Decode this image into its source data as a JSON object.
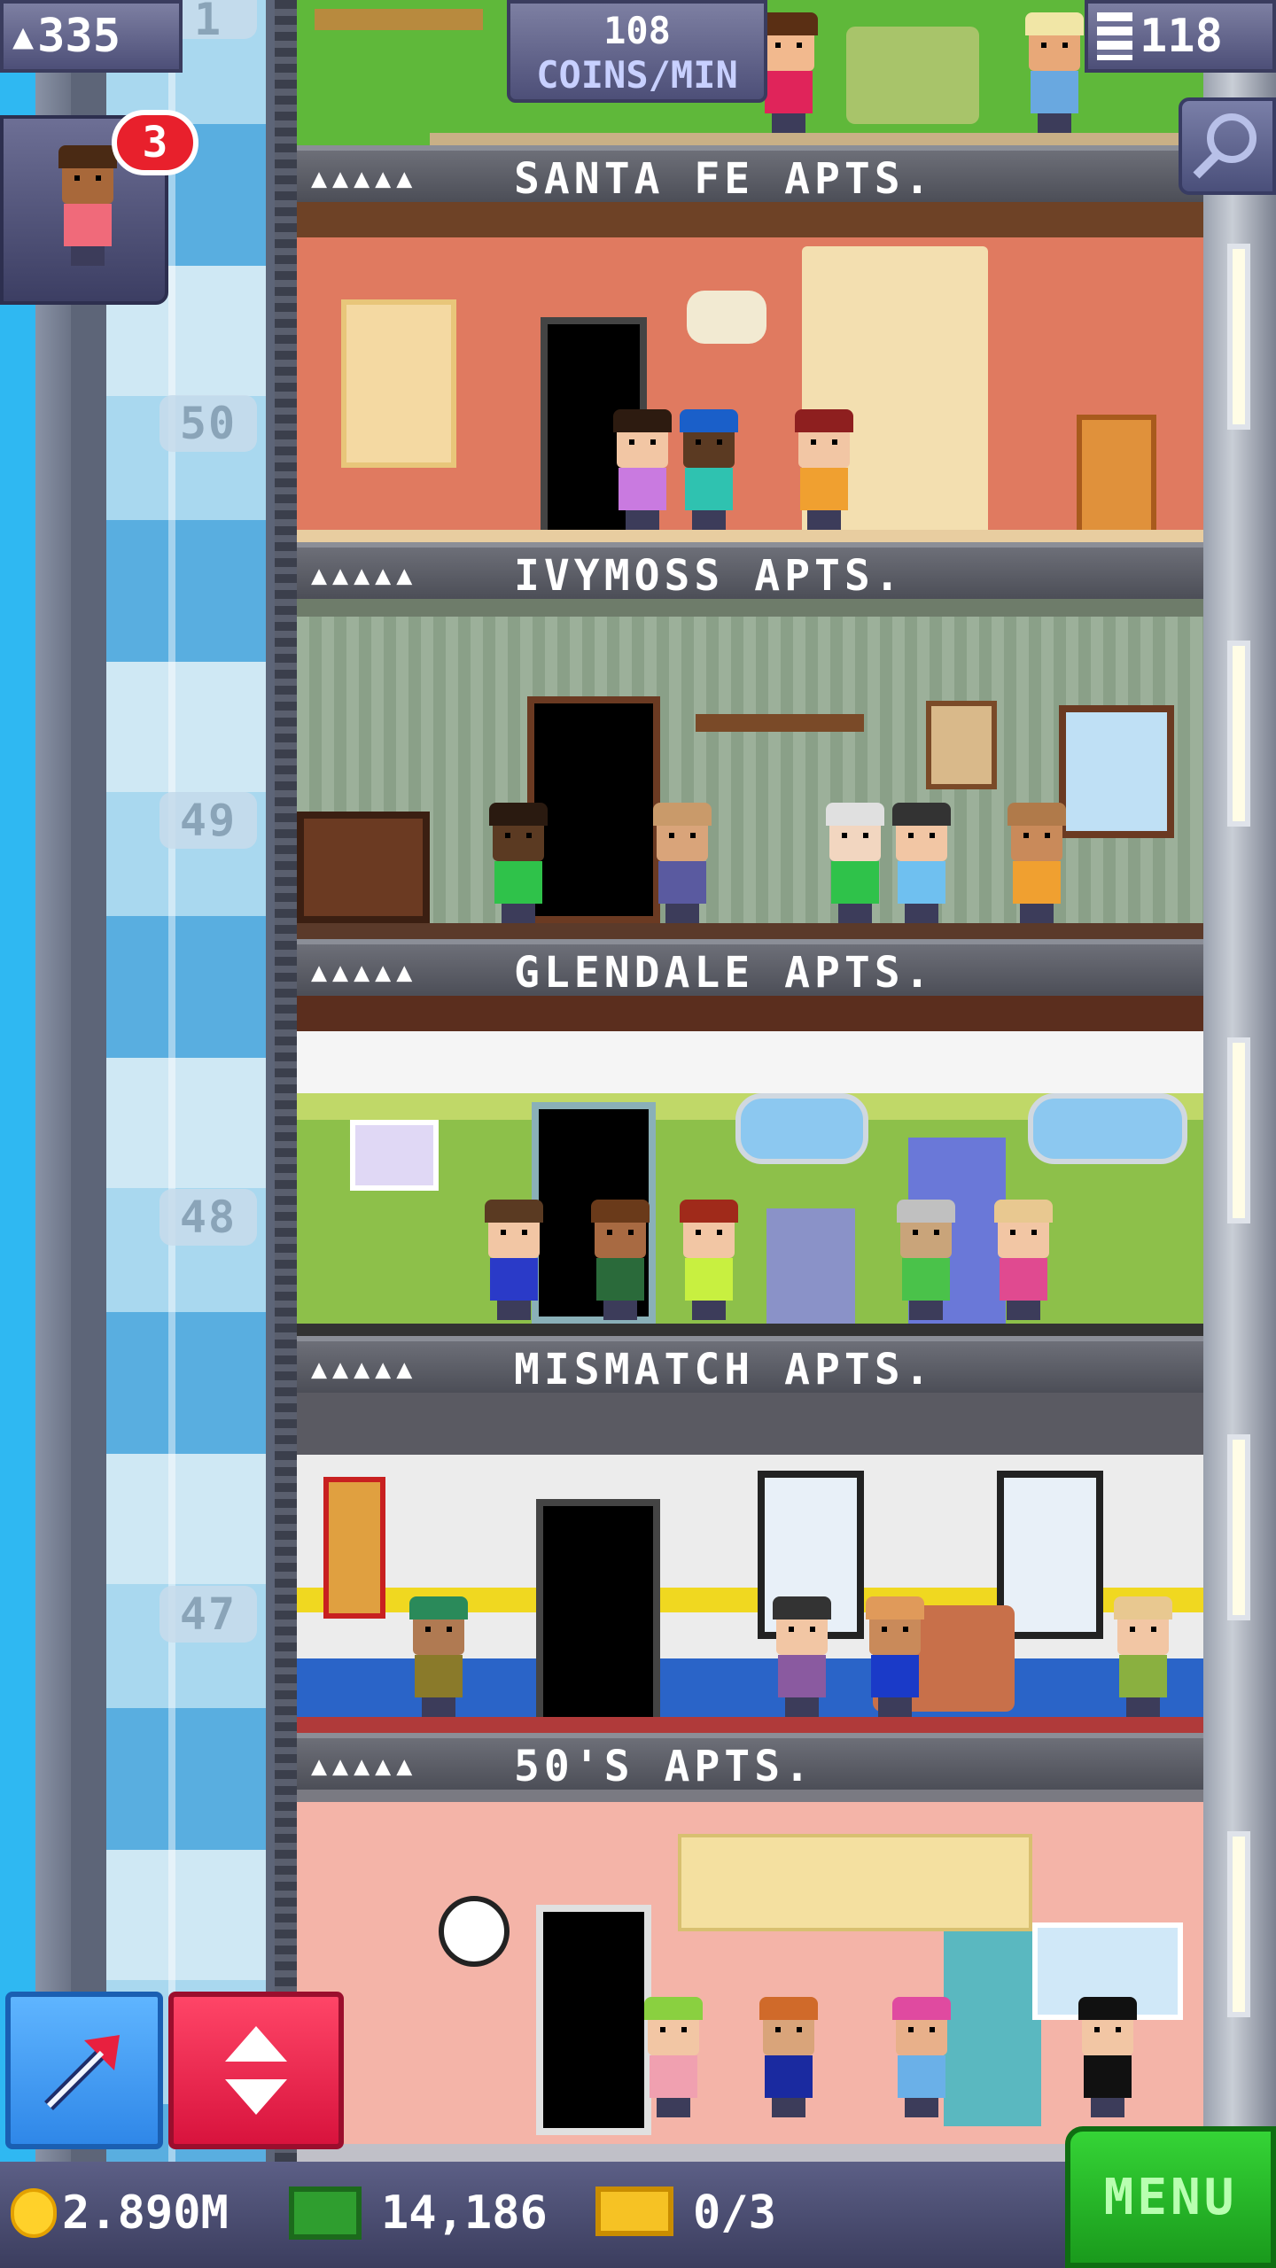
{
  "hud": {
    "population": "335",
    "coins_rate_value": "108",
    "coins_rate_unit": "COINS/MIN",
    "floors": "118",
    "visitor_count": "3"
  },
  "floor_numbers": [
    "1",
    "50",
    "49",
    "48",
    "47"
  ],
  "floors": [
    {
      "name": "SANTA FE APTS.",
      "stars": "▲▲▲▲▲"
    },
    {
      "name": "IVYMOSS APTS.",
      "stars": "▲▲▲▲▲"
    },
    {
      "name": "GLENDALE APTS.",
      "stars": "▲▲▲▲▲"
    },
    {
      "name": "MISMATCH APTS.",
      "stars": "▲▲▲▲▲"
    },
    {
      "name": "50'S APTS.",
      "stars": "▲▲▲▲▲"
    }
  ],
  "bottom_bar": {
    "coins": "2.890M",
    "tower_bux": "14,186",
    "tickets": "0/3",
    "menu_label": "MENU"
  },
  "colors": {
    "sky": "#2fb8f2",
    "hud": "#5a5c84",
    "menu": "#2fc22f",
    "elevator_button": "#e8203f",
    "build_button": "#3f9cf5",
    "badge": "#e8202c"
  },
  "icons": [
    "person-icon",
    "building-icon",
    "magnify-icon",
    "arrow-icon",
    "up-down-icon",
    "coin-icon",
    "bux-icon",
    "ticket-icon"
  ]
}
